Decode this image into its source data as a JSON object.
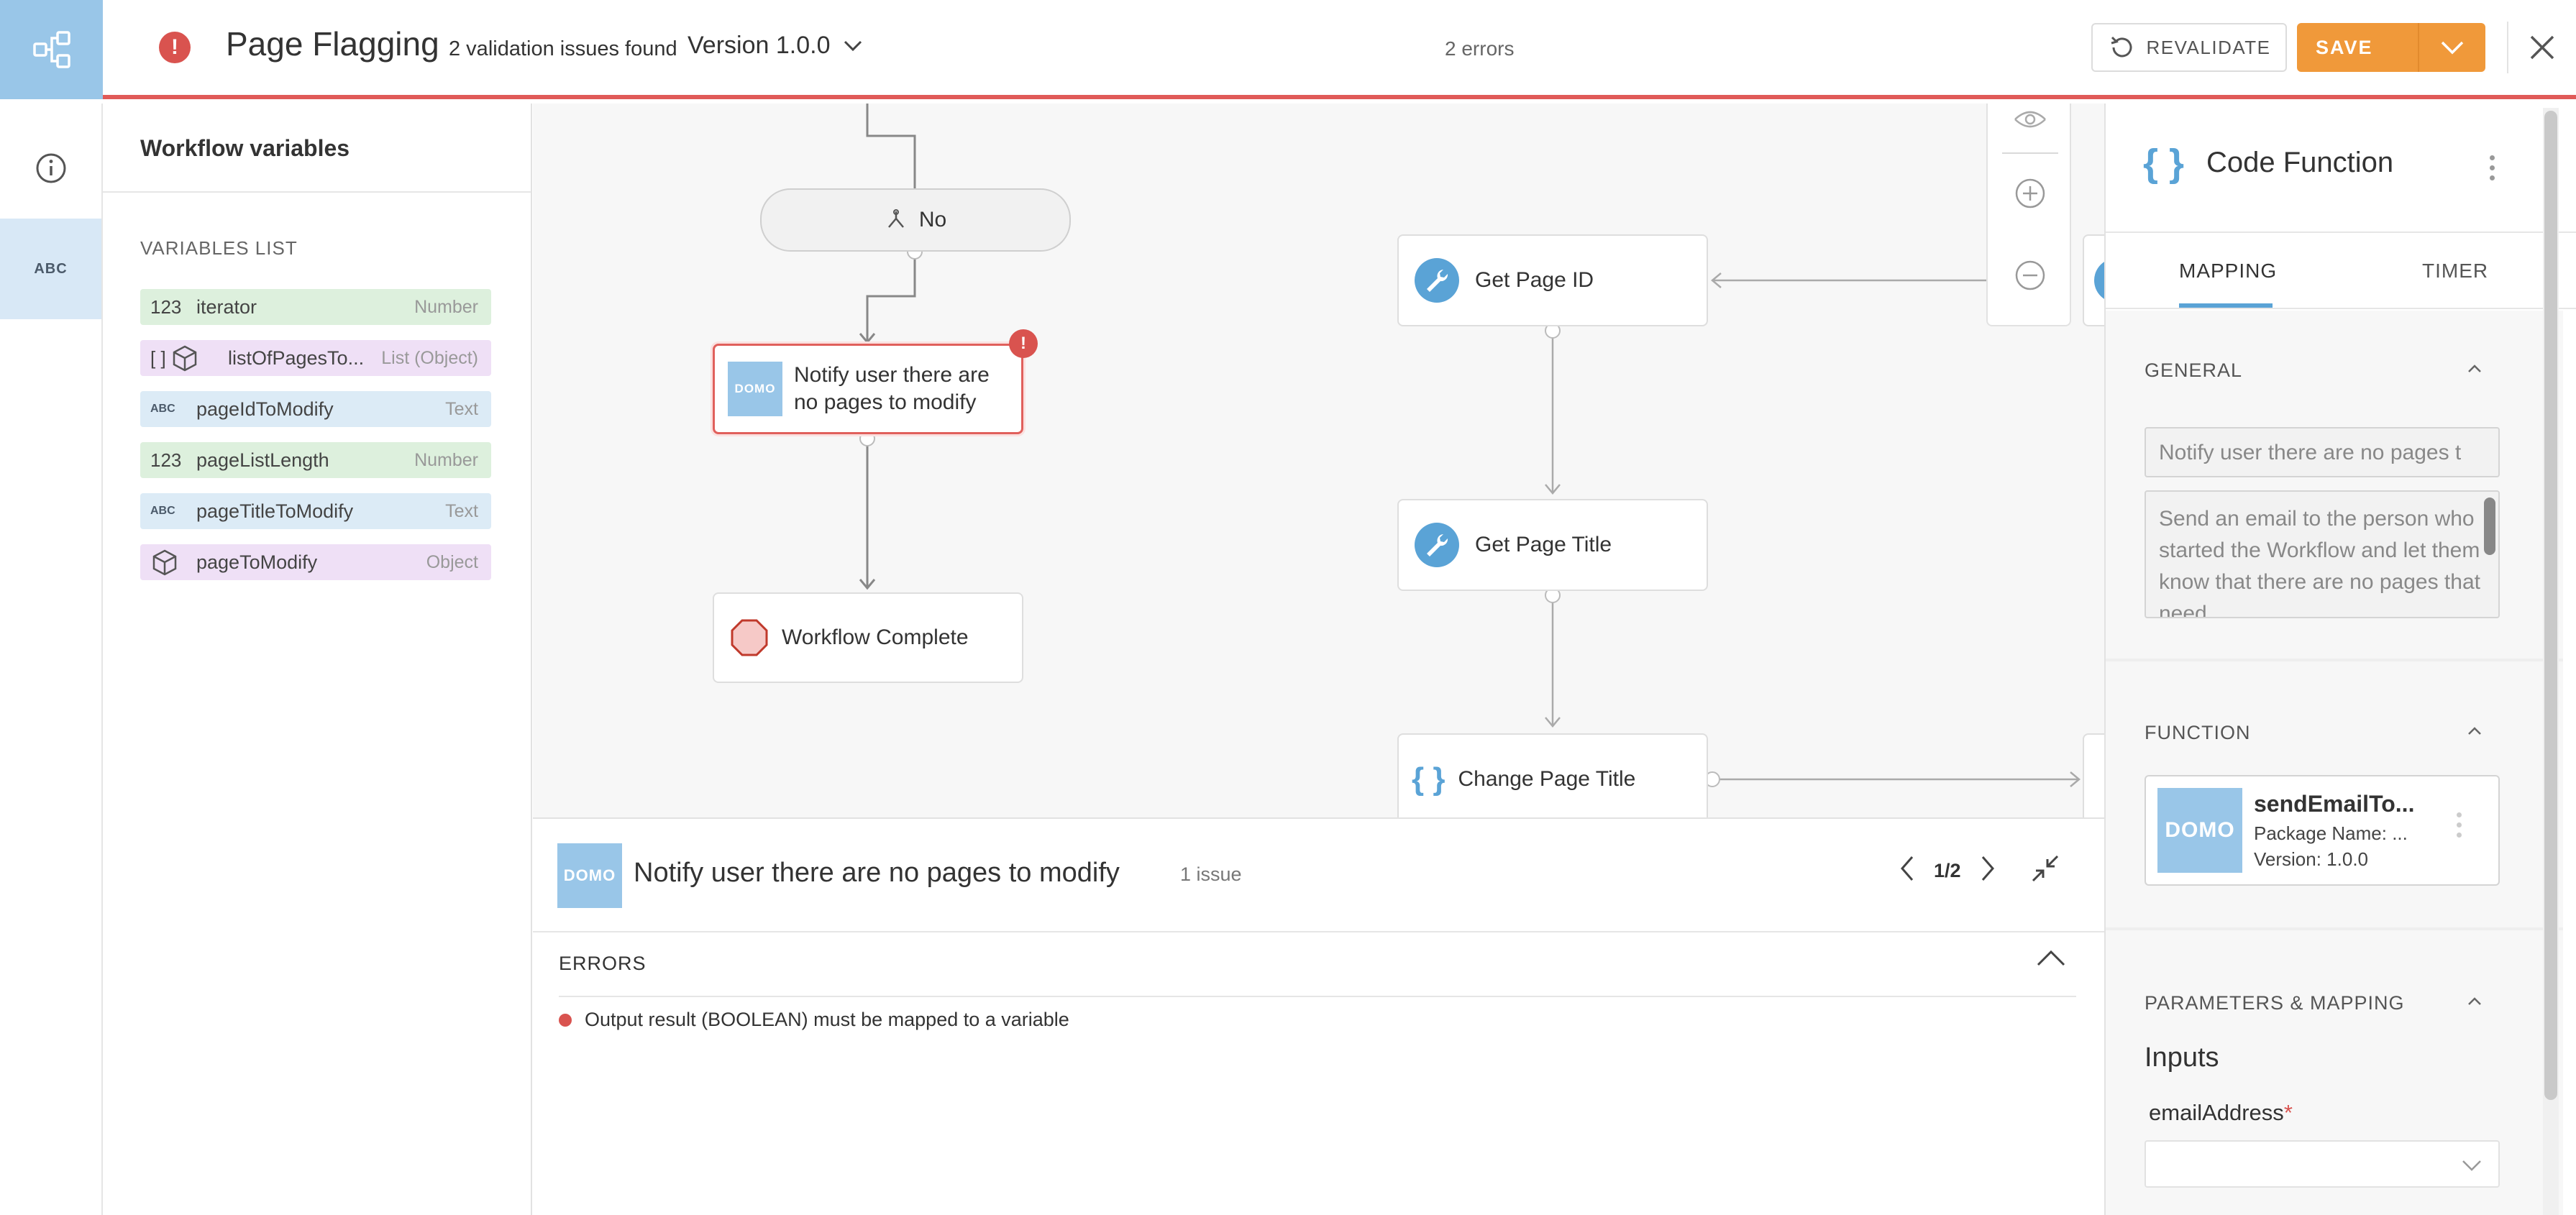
{
  "header": {
    "title": "Page Flagging",
    "validation_note": "2 validation issues found",
    "version": "Version 1.0.0",
    "errors_count": "2 errors",
    "revalidate_label": "REVALIDATE",
    "save_label": "SAVE",
    "accent": "#f0993a",
    "error_color": "#d9534f"
  },
  "rail": {
    "items": [
      {
        "icon": "info-icon"
      },
      {
        "icon": "abc-icon",
        "label": "ABC"
      }
    ]
  },
  "variables": {
    "panel_title": "Workflow variables",
    "list_title": "VARIABLES LIST",
    "items": [
      {
        "icon": "123",
        "name": "iterator",
        "type": "Number"
      },
      {
        "icon": "[ ]",
        "name": "listOfPagesTo...",
        "type": "List (Object)"
      },
      {
        "icon": "ABC",
        "name": "pageIdToModify",
        "type": "Text"
      },
      {
        "icon": "123",
        "name": "pageListLength",
        "type": "Number"
      },
      {
        "icon": "ABC",
        "name": "pageTitleToModify",
        "type": "Text"
      },
      {
        "icon": "cube",
        "name": "pageToModify",
        "type": "Object"
      }
    ]
  },
  "canvas": {
    "nodes": {
      "no_gate": "No",
      "notify": "Notify user there are no pages to modify",
      "notify_line1": "Notify user there are",
      "notify_line2": "no pages to modify",
      "notify_badge": "!",
      "complete": "Workflow Complete",
      "get_page_id": "Get Page ID",
      "get_page_title": "Get Page Title",
      "change_page_title": "Change Page Title",
      "domo_tile": "DOMO"
    }
  },
  "issues": {
    "tile": "DOMO",
    "title": "Notify user there are no pages to modify",
    "count": "1 issue",
    "pager": "1/2",
    "errors_label": "ERRORS",
    "errors": [
      "Output result (BOOLEAN) must be mapped to a variable"
    ]
  },
  "props": {
    "title": "Code Function",
    "braces": "{ }",
    "tabs": [
      {
        "label": "MAPPING",
        "active": true
      },
      {
        "label": "TIMER",
        "active": false
      }
    ],
    "general": {
      "title": "GENERAL",
      "name_value": "Notify user there are no pages t",
      "description_value": "Send an email to the person who started the Workflow and let them know that there are no pages that need"
    },
    "function": {
      "title": "FUNCTION",
      "tile": "DOMO",
      "name": "sendEmailTo...",
      "package": "Package Name: ...",
      "version": "Version: 1.0.0"
    },
    "parameters": {
      "title": "PARAMETERS & MAPPING",
      "inputs_title": "Inputs",
      "param_name": "emailAddress",
      "required_mark": "*"
    }
  }
}
